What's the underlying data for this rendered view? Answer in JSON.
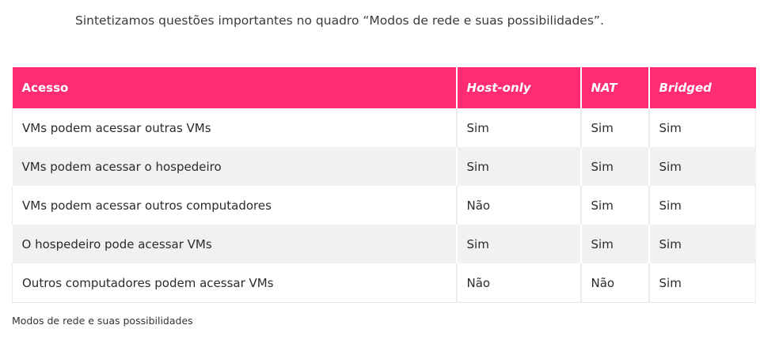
{
  "intro": "Sintetizamos questões importantes no quadro “Modos de rede e suas possibilidades”.",
  "table": {
    "headers": [
      "Acesso",
      "Host-only",
      "NAT",
      "Bridged"
    ],
    "rows": [
      [
        "VMs podem acessar outras VMs",
        "Sim",
        "Sim",
        "Sim"
      ],
      [
        "VMs podem acessar o hospedeiro",
        "Sim",
        "Sim",
        "Sim"
      ],
      [
        "VMs podem acessar outros computadores",
        "Não",
        "Sim",
        "Sim"
      ],
      [
        "O hospedeiro pode acessar VMs",
        "Sim",
        "Sim",
        "Sim"
      ],
      [
        "Outros computadores podem acessar VMs",
        "Não",
        "Não",
        "Sim"
      ]
    ],
    "colors": {
      "header_bg": "#ff2b73",
      "header_text": "#ffffff",
      "zebra": "#f1f1f1"
    }
  },
  "caption": "Modos de rede e suas possibilidades"
}
